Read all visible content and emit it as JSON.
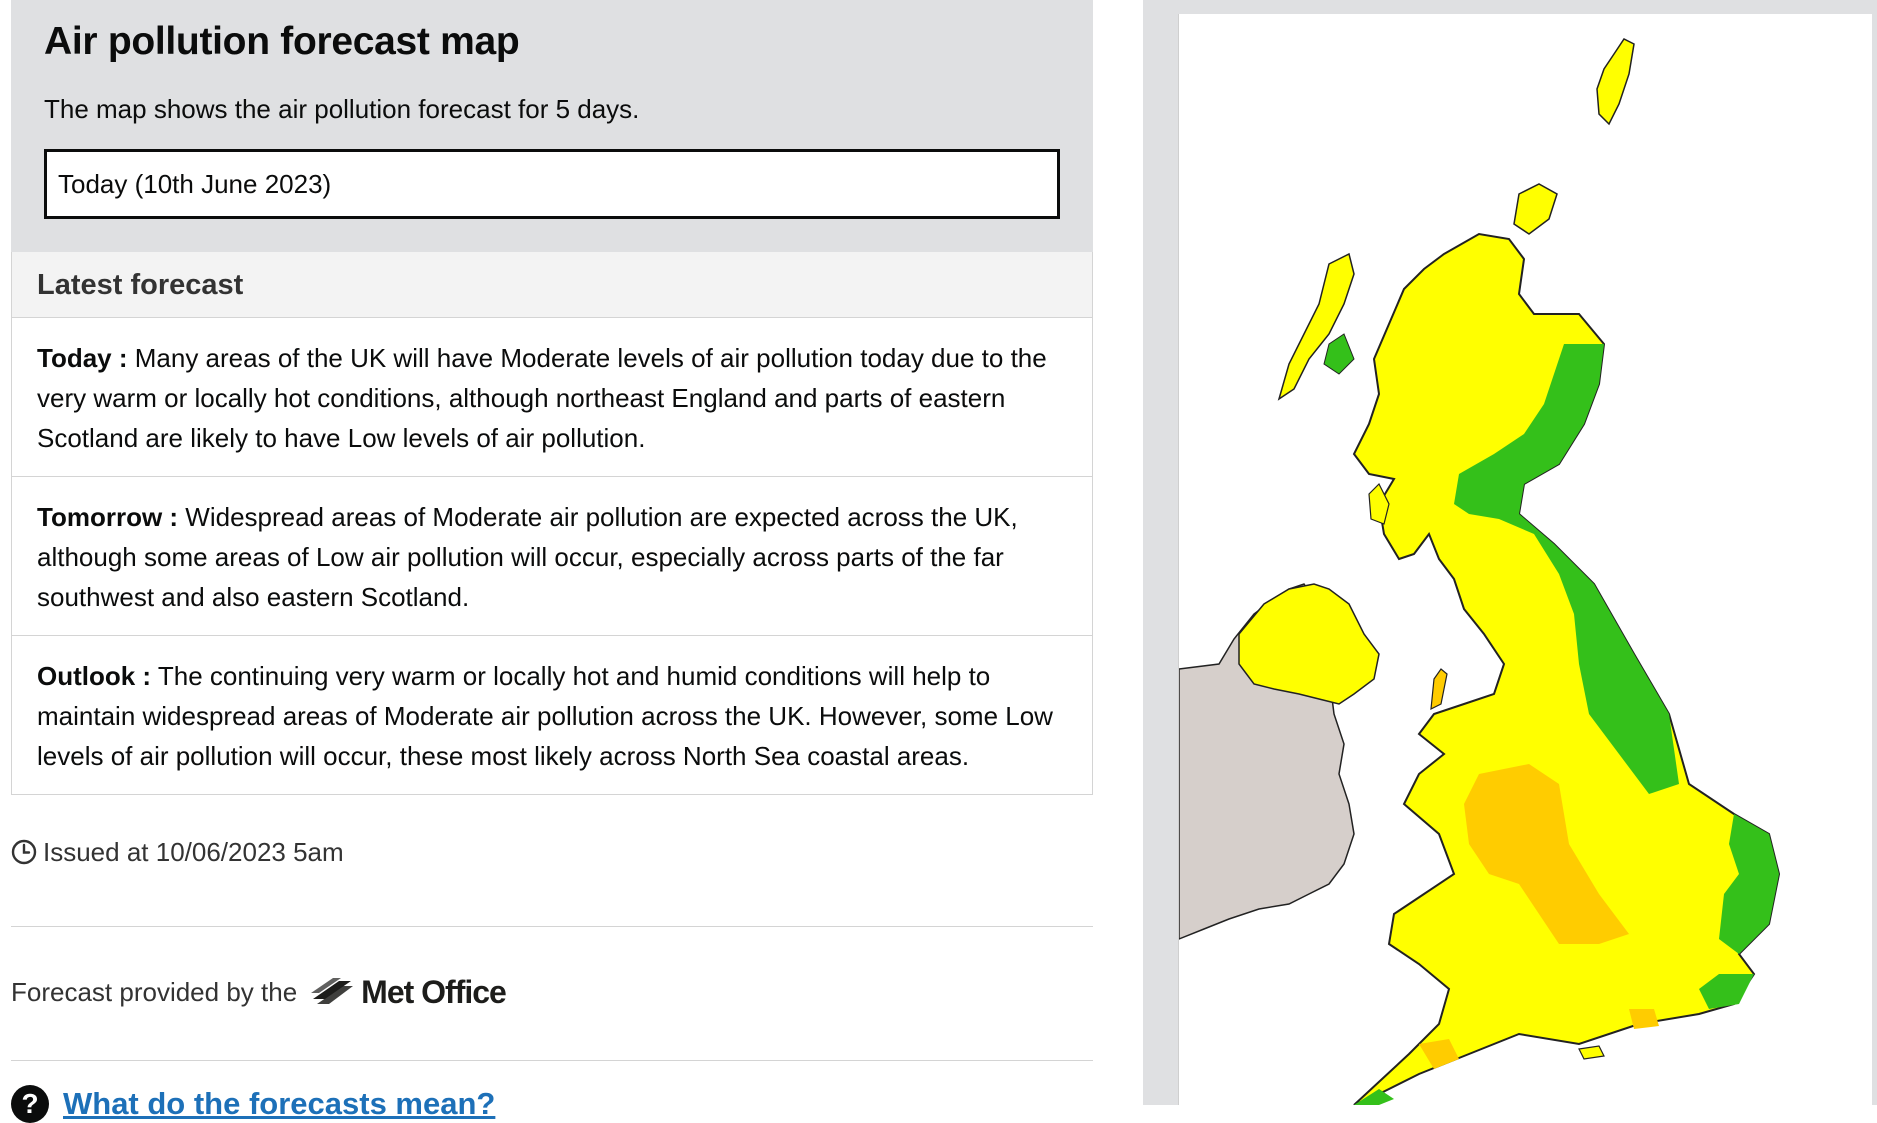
{
  "header": {
    "title": "Air pollution forecast map",
    "intro": "The map shows the air pollution forecast for 5 days.",
    "day_select_value": "Today (10th June 2023)"
  },
  "forecast": {
    "heading": "Latest forecast",
    "items": [
      {
        "label": "Today :",
        "text": " Many areas of the UK will have Moderate levels of air pollution today due to the very warm or locally hot conditions, although northeast England and parts of eastern Scotland are likely to have Low levels of air pollution."
      },
      {
        "label": "Tomorrow :",
        "text": " Widespread areas of Moderate air pollution are expected across the UK, although some areas of Low air pollution will occur, especially across parts of the far southwest and also eastern Scotland."
      },
      {
        "label": "Outlook :",
        "text": " The continuing very warm or locally hot and humid conditions will help to maintain widespread areas of Moderate air pollution across the UK. However, some Low levels of air pollution will occur, these most likely across North Sea coastal areas."
      }
    ]
  },
  "issued": "Issued at 10/06/2023 5am",
  "provider": {
    "prefix": "Forecast provided by the",
    "logo_text": "Met Office"
  },
  "faq": {
    "icon": "?",
    "link_text": "What do the forecasts mean?"
  },
  "map": {
    "icons": {
      "clock": "clock-icon",
      "met_office_logo": "met-office-logo"
    },
    "colors": {
      "low": "#34c01a",
      "moderate": "#ffff00",
      "moderate_high": "#ffcc00",
      "ireland": "#d6cfcb",
      "background": "#dfe0e2"
    }
  }
}
